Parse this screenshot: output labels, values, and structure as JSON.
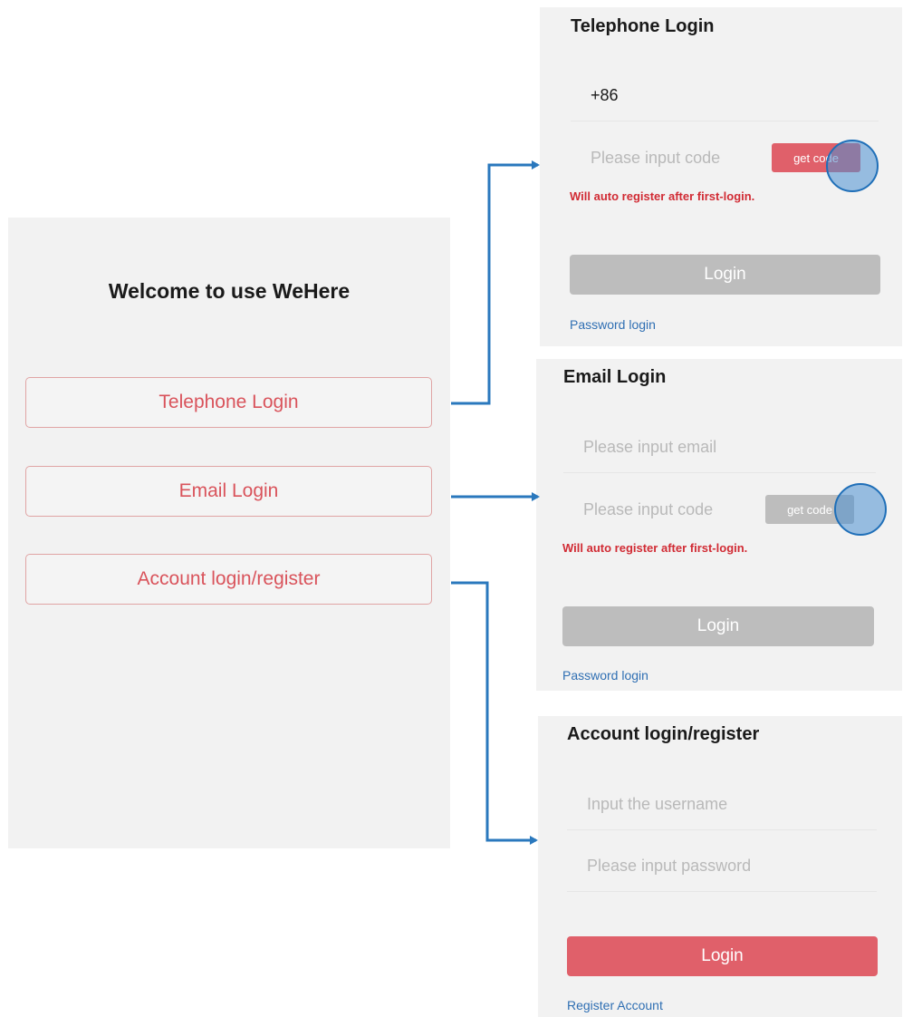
{
  "main": {
    "title": "Welcome to use WeHere",
    "buttons": [
      "Telephone Login",
      "Email Login",
      "Account login/register"
    ]
  },
  "telephone": {
    "title": "Telephone Login",
    "country_code": "+86",
    "code_placeholder": "Please input code",
    "get_code_label": "get code",
    "hint": "Will auto register after first-login.",
    "login_label": "Login",
    "password_link": "Password login"
  },
  "email": {
    "title": "Email Login",
    "email_placeholder": "Please input email",
    "code_placeholder": "Please input code",
    "get_code_label": "get code",
    "hint": "Will auto register after first-login.",
    "login_label": "Login",
    "password_link": "Password login"
  },
  "account": {
    "title": "Account login/register",
    "username_placeholder": "Input the username",
    "password_placeholder": "Please input password",
    "login_label": "Login",
    "register_link": "Register Account"
  },
  "colors": {
    "accent_red": "#e0606a",
    "disabled_gray": "#bdbdbd",
    "arrow_blue": "#2a78bd",
    "link_blue": "#2f6fb3"
  }
}
